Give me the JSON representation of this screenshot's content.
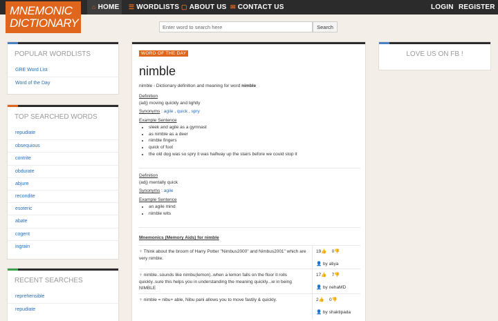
{
  "logo": {
    "line1": "MNEMONIC",
    "line2": "DICTIONARY"
  },
  "nav": {
    "home": "HOME",
    "wordlists": "WORDLISTS",
    "about": "ABOUT US",
    "contact": "CONTACT US",
    "login": "LOGIN",
    "register": "REGISTER"
  },
  "search": {
    "placeholder": "Enter word to search here",
    "button": "Search"
  },
  "popular": {
    "title": "POPULAR WORDLISTS",
    "items": [
      "GRE Word List",
      "Word of the Day"
    ]
  },
  "top_searched": {
    "title": "TOP SEARCHED WORDS",
    "items": [
      "repudiate",
      "obsequious",
      "contrite",
      "obdurate",
      "abjure",
      "recondite",
      "esoteric",
      "abate",
      "cogent",
      "ingrain"
    ]
  },
  "recent": {
    "title": "RECENT SEARCHES",
    "items": [
      "reprehensible",
      "repudiate"
    ]
  },
  "fb": {
    "title": "LOVE US ON FB !"
  },
  "colors": {
    "accent": "#e0651d",
    "blue_accent": "#4a7fc1",
    "green_accent": "#3aa04a",
    "nav_bg": "#2b2b2b",
    "link": "#2a6db0"
  },
  "word": {
    "badge": "WORD OF THE DAY",
    "title": "nimble",
    "intro_prefix": "nimble - Dictionary definition and meaning for word ",
    "intro_word": "nimble",
    "definition_label": "Definition",
    "synonyms_label": "Synonyms",
    "example_label": "Example Sentence",
    "senses": [
      {
        "definition": "(adj) moving quickly and lightly",
        "synonyms": [
          "agile",
          "quick",
          "spry"
        ],
        "examples": [
          "sleek and agile as a gymnast",
          "as nimble as a deer",
          "nimble fingers",
          "quick of foot",
          "the old dog was so spry it was halfway up the stairs before we could stop it"
        ]
      },
      {
        "definition": "(adj) mentally quick",
        "synonyms": [
          "agile"
        ],
        "examples": [
          "an agile mind",
          "nimble wits"
        ]
      }
    ]
  },
  "mnemonics": {
    "title": "Mnemonics (Memory Aids) for nimble",
    "by_label": "by",
    "items": [
      {
        "text": "Think about the broom of Harry Potter \"Nimbus2000\" and Nimbus2001\" which are very nimble.",
        "up": "19",
        "down": "0",
        "author": "atiya"
      },
      {
        "text": "nimble..sounds like nimbu(lemon)..when a lemon falls on the floor it rolls quickly..sure this helps you in understanding the meaning quickly...ie in being NIMBLE",
        "up": "17",
        "down": "7",
        "author": "nehaMD"
      },
      {
        "text": "nimble = nibu+ able, Nibu pani allows you to move fastily & quickly.",
        "up": "2",
        "down": "0",
        "author": "shaktipada"
      }
    ]
  }
}
